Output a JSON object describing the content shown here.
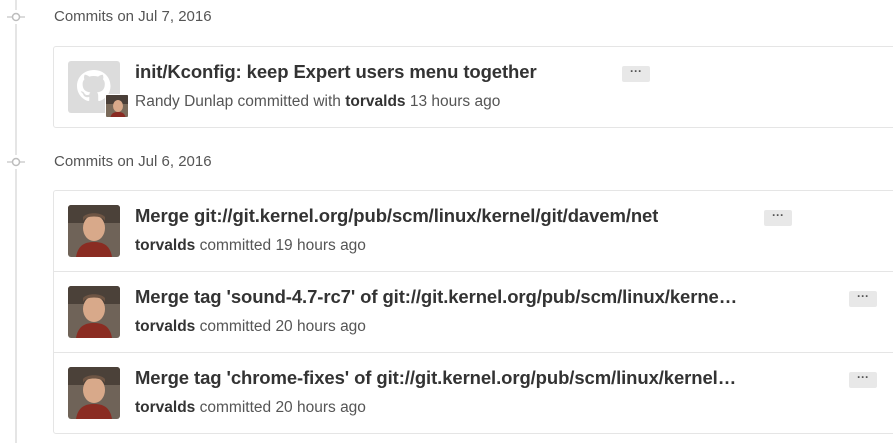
{
  "groups": [
    {
      "title": "Commits on Jul 7, 2016",
      "commits": [
        {
          "message": "init/Kconfig: keep Expert users menu together",
          "author": "Randy Dunlap",
          "action": "committed with",
          "committer": "torvalds",
          "time": "13 hours ago",
          "avatar": "github-octocat-icon",
          "ellipsis": "···"
        }
      ]
    },
    {
      "title": "Commits on Jul 6, 2016",
      "commits": [
        {
          "message": "Merge git://git.kernel.org/pub/scm/linux/kernel/git/davem/net",
          "author": "torvalds",
          "action": "committed",
          "time": "19 hours ago",
          "avatar": "torvalds-photo",
          "ellipsis": "···"
        },
        {
          "message": "Merge tag 'sound-4.7-rc7' of git://git.kernel.org/pub/scm/linux/kerne…",
          "author": "torvalds",
          "action": "committed",
          "time": "20 hours ago",
          "avatar": "torvalds-photo",
          "ellipsis": "···"
        },
        {
          "message": "Merge tag 'chrome-fixes' of git://git.kernel.org/pub/scm/linux/kernel…",
          "author": "torvalds",
          "action": "committed",
          "time": "20 hours ago",
          "avatar": "torvalds-photo",
          "ellipsis": "···"
        }
      ]
    }
  ],
  "colors": {
    "border": "#e5e5e5",
    "title_text": "#333333",
    "meta_text": "#555555",
    "ellipsis_bg": "#e8e8e8"
  }
}
